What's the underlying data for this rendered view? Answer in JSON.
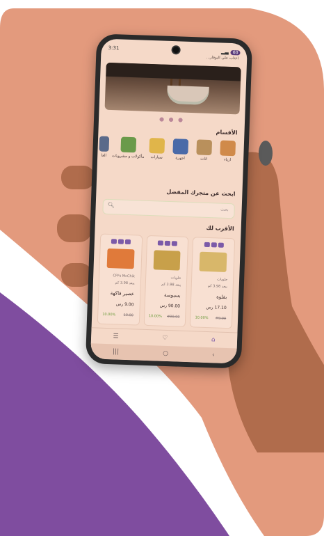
{
  "status_bar": {
    "time": "3:31",
    "battery": "60"
  },
  "address": "اعتاب على البوفار...",
  "sections": {
    "categories_title": "الأقسام",
    "search_title": "ابحث عن متجرك المفضل",
    "nearby_title": "الأقرب لك"
  },
  "categories": [
    {
      "label": "ازياء",
      "color": "#d08a4a"
    },
    {
      "label": "اثاث",
      "color": "#b9905c"
    },
    {
      "label": "اجهزة",
      "color": "#4a6aa8"
    },
    {
      "label": "سيارات",
      "color": "#e0b54a"
    },
    {
      "label": "مأكولات و مشروبات",
      "color": "#6a9a4a"
    },
    {
      "label": "العا",
      "color": "#5a6a8a"
    }
  ],
  "search": {
    "placeholder": "بحث"
  },
  "cards": [
    {
      "store": "حلويات",
      "distance": "يبعد 3.98 كم",
      "name": "بقلوة",
      "price": "17.10 رس",
      "old": "#9.00",
      "discount": "10.00%",
      "img_color": "#d8b76a"
    },
    {
      "store": "حلويات",
      "distance": "يبعد 3.98 كم",
      "name": "بسبوسة",
      "price": "90.00 رس",
      "old": "#00.00",
      "discount": "10.00%",
      "img_color": "#c8a04a"
    },
    {
      "store": "CFFs McChik",
      "distance": "يبعد 3.98 كم",
      "name": "عصير فاكهة",
      "price": "9.00 رس",
      "old": "10.00",
      "discount": "10.00%",
      "img_color": "#e07a3a"
    }
  ],
  "colors": {
    "background_orange": "#e39a7d",
    "accent_purple": "#7f4d9f"
  }
}
